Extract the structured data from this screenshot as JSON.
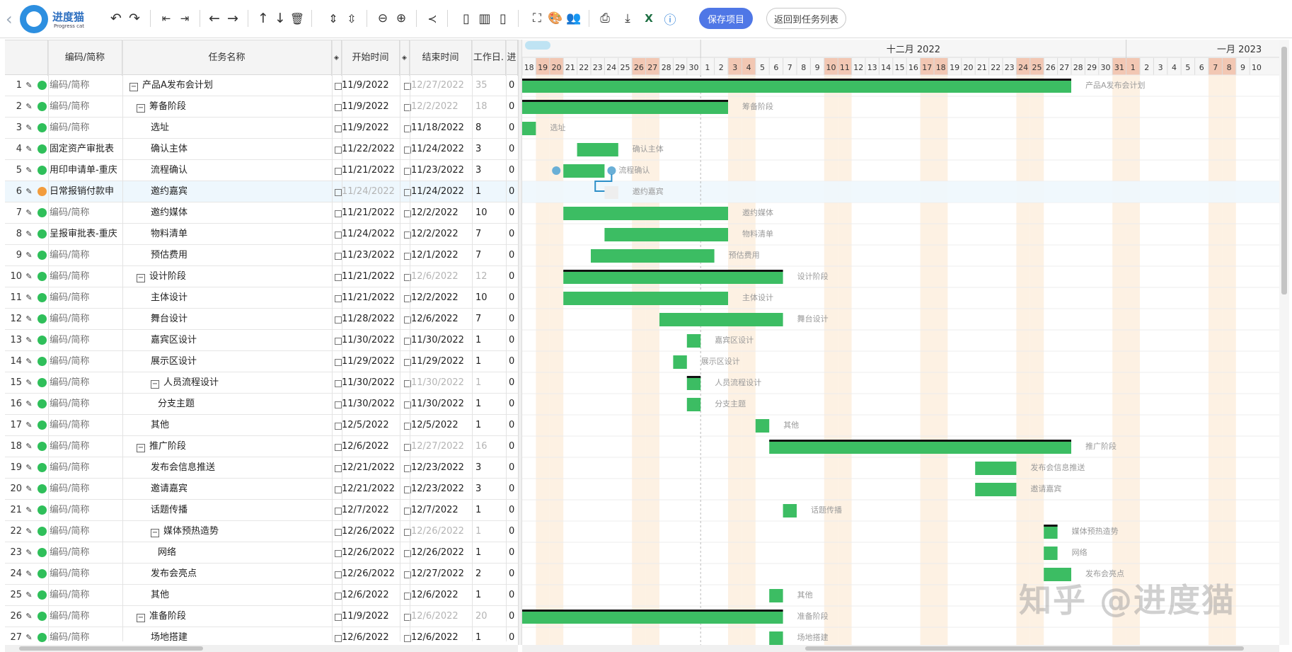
{
  "app": {
    "logo_name": "进度猫",
    "logo_sub": "Progress cat",
    "save_label": "保存项目",
    "back_label": "返回到任务列表"
  },
  "toolbar_icons": [
    "undo-icon",
    "redo-icon",
    "outdent-icon",
    "indent-icon",
    "move-left-icon",
    "move-right-icon",
    "move-up-icon",
    "move-down-icon",
    "delete-icon",
    "expand-all-icon",
    "collapse-all-icon",
    "zoom-out-icon",
    "zoom-in-icon",
    "critical-path-icon",
    "layout-left-icon",
    "layout-both-icon",
    "layout-right-icon",
    "fullscreen-icon",
    "color-palette-icon",
    "resources-icon",
    "print-icon",
    "export-icon",
    "excel-icon",
    "help-icon"
  ],
  "grid": {
    "headers": {
      "code": "编码/简称",
      "name": "任务名称",
      "start": "开始时间",
      "end": "结束时间",
      "duration": "工作日.",
      "progress": "进"
    },
    "rows": [
      {
        "idx": "1",
        "code": "编码/简称",
        "code_real": false,
        "name": "产品A发布会计划",
        "level": 0,
        "group": true,
        "start": "11/9/2022",
        "end": "12/27/2022",
        "dur": "35",
        "prog": "0",
        "dot": "green",
        "start_gray": false,
        "end_gray": true,
        "dur_gray": true
      },
      {
        "idx": "2",
        "code": "编码/简称",
        "code_real": false,
        "name": "筹备阶段",
        "level": 1,
        "group": true,
        "start": "11/9/2022",
        "end": "12/2/2022",
        "dur": "18",
        "prog": "0",
        "dot": "green",
        "start_gray": false,
        "end_gray": true,
        "dur_gray": true
      },
      {
        "idx": "3",
        "code": "编码/简称",
        "code_real": false,
        "name": "选址",
        "level": 2,
        "group": false,
        "start": "11/9/2022",
        "end": "11/18/2022",
        "dur": "8",
        "prog": "0",
        "dot": "green",
        "start_gray": false,
        "end_gray": false,
        "dur_gray": false
      },
      {
        "idx": "4",
        "code": "固定资产审批表",
        "code_real": true,
        "name": "确认主体",
        "level": 2,
        "group": false,
        "start": "11/22/2022",
        "end": "11/24/2022",
        "dur": "3",
        "prog": "0",
        "dot": "green",
        "start_gray": false,
        "end_gray": false,
        "dur_gray": false
      },
      {
        "idx": "5",
        "code": "用印申请单-重庆",
        "code_real": true,
        "name": "流程确认",
        "level": 2,
        "group": false,
        "start": "11/21/2022",
        "end": "11/23/2022",
        "dur": "3",
        "prog": "0",
        "dot": "green",
        "start_gray": false,
        "end_gray": false,
        "dur_gray": false
      },
      {
        "idx": "6",
        "code": "日常报销付款申",
        "code_real": true,
        "name": "邀约嘉宾",
        "level": 2,
        "group": false,
        "start": "11/24/2022",
        "end": "11/24/2022",
        "dur": "1",
        "prog": "0",
        "dot": "orange",
        "start_gray": true,
        "end_gray": false,
        "dur_gray": false,
        "selected": true
      },
      {
        "idx": "7",
        "code": "编码/简称",
        "code_real": false,
        "name": "邀约媒体",
        "level": 2,
        "group": false,
        "start": "11/21/2022",
        "end": "12/2/2022",
        "dur": "10",
        "prog": "0",
        "dot": "green",
        "start_gray": false,
        "end_gray": false,
        "dur_gray": false
      },
      {
        "idx": "8",
        "code": "呈报审批表-重庆",
        "code_real": true,
        "name": "物料清单",
        "level": 2,
        "group": false,
        "start": "11/24/2022",
        "end": "12/2/2022",
        "dur": "7",
        "prog": "0",
        "dot": "green",
        "start_gray": false,
        "end_gray": false,
        "dur_gray": false
      },
      {
        "idx": "9",
        "code": "编码/简称",
        "code_real": false,
        "name": "预估费用",
        "level": 2,
        "group": false,
        "start": "11/23/2022",
        "end": "12/1/2022",
        "dur": "7",
        "prog": "0",
        "dot": "green",
        "start_gray": false,
        "end_gray": false,
        "dur_gray": false
      },
      {
        "idx": "10",
        "code": "编码/简称",
        "code_real": false,
        "name": "设计阶段",
        "level": 1,
        "group": true,
        "start": "11/21/2022",
        "end": "12/6/2022",
        "dur": "12",
        "prog": "0",
        "dot": "green",
        "start_gray": false,
        "end_gray": true,
        "dur_gray": true
      },
      {
        "idx": "11",
        "code": "编码/简称",
        "code_real": false,
        "name": "主体设计",
        "level": 2,
        "group": false,
        "start": "11/21/2022",
        "end": "12/2/2022",
        "dur": "10",
        "prog": "0",
        "dot": "green",
        "start_gray": false,
        "end_gray": false,
        "dur_gray": false
      },
      {
        "idx": "12",
        "code": "编码/简称",
        "code_real": false,
        "name": "舞台设计",
        "level": 2,
        "group": false,
        "start": "11/28/2022",
        "end": "12/6/2022",
        "dur": "7",
        "prog": "0",
        "dot": "green",
        "start_gray": false,
        "end_gray": false,
        "dur_gray": false
      },
      {
        "idx": "13",
        "code": "编码/简称",
        "code_real": false,
        "name": "嘉宾区设计",
        "level": 2,
        "group": false,
        "start": "11/30/2022",
        "end": "11/30/2022",
        "dur": "1",
        "prog": "0",
        "dot": "green",
        "start_gray": false,
        "end_gray": false,
        "dur_gray": false
      },
      {
        "idx": "14",
        "code": "编码/简称",
        "code_real": false,
        "name": "展示区设计",
        "level": 2,
        "group": false,
        "start": "11/29/2022",
        "end": "11/29/2022",
        "dur": "1",
        "prog": "0",
        "dot": "green",
        "start_gray": false,
        "end_gray": false,
        "dur_gray": false
      },
      {
        "idx": "15",
        "code": "编码/简称",
        "code_real": false,
        "name": "人员流程设计",
        "level": 2,
        "group": true,
        "start": "11/30/2022",
        "end": "11/30/2022",
        "dur": "1",
        "prog": "0",
        "dot": "green",
        "start_gray": false,
        "end_gray": true,
        "dur_gray": true
      },
      {
        "idx": "16",
        "code": "编码/简称",
        "code_real": false,
        "name": "分支主题",
        "level": 3,
        "group": false,
        "start": "11/30/2022",
        "end": "11/30/2022",
        "dur": "1",
        "prog": "0",
        "dot": "green",
        "start_gray": false,
        "end_gray": false,
        "dur_gray": false
      },
      {
        "idx": "17",
        "code": "编码/简称",
        "code_real": false,
        "name": "其他",
        "level": 2,
        "group": false,
        "start": "12/5/2022",
        "end": "12/5/2022",
        "dur": "1",
        "prog": "0",
        "dot": "green",
        "start_gray": false,
        "end_gray": false,
        "dur_gray": false
      },
      {
        "idx": "18",
        "code": "编码/简称",
        "code_real": false,
        "name": "推广阶段",
        "level": 1,
        "group": true,
        "start": "12/6/2022",
        "end": "12/27/2022",
        "dur": "16",
        "prog": "0",
        "dot": "green",
        "start_gray": false,
        "end_gray": true,
        "dur_gray": true
      },
      {
        "idx": "19",
        "code": "编码/简称",
        "code_real": false,
        "name": "发布会信息推送",
        "level": 2,
        "group": false,
        "start": "12/21/2022",
        "end": "12/23/2022",
        "dur": "3",
        "prog": "0",
        "dot": "green",
        "start_gray": false,
        "end_gray": false,
        "dur_gray": false
      },
      {
        "idx": "20",
        "code": "编码/简称",
        "code_real": false,
        "name": "邀请嘉宾",
        "level": 2,
        "group": false,
        "start": "12/21/2022",
        "end": "12/23/2022",
        "dur": "3",
        "prog": "0",
        "dot": "green",
        "start_gray": false,
        "end_gray": false,
        "dur_gray": false
      },
      {
        "idx": "21",
        "code": "编码/简称",
        "code_real": false,
        "name": "话题传播",
        "level": 2,
        "group": false,
        "start": "12/7/2022",
        "end": "12/7/2022",
        "dur": "1",
        "prog": "0",
        "dot": "green",
        "start_gray": false,
        "end_gray": false,
        "dur_gray": false
      },
      {
        "idx": "22",
        "code": "编码/简称",
        "code_real": false,
        "name": "媒体预热造势",
        "level": 2,
        "group": true,
        "start": "12/26/2022",
        "end": "12/26/2022",
        "dur": "1",
        "prog": "0",
        "dot": "green",
        "start_gray": false,
        "end_gray": true,
        "dur_gray": true
      },
      {
        "idx": "23",
        "code": "编码/简称",
        "code_real": false,
        "name": "网络",
        "level": 3,
        "group": false,
        "start": "12/26/2022",
        "end": "12/26/2022",
        "dur": "1",
        "prog": "0",
        "dot": "green",
        "start_gray": false,
        "end_gray": false,
        "dur_gray": false
      },
      {
        "idx": "24",
        "code": "编码/简称",
        "code_real": false,
        "name": "发布会亮点",
        "level": 2,
        "group": false,
        "start": "12/26/2022",
        "end": "12/27/2022",
        "dur": "2",
        "prog": "0",
        "dot": "green",
        "start_gray": false,
        "end_gray": false,
        "dur_gray": false
      },
      {
        "idx": "25",
        "code": "编码/简称",
        "code_real": false,
        "name": "其他",
        "level": 2,
        "group": false,
        "start": "12/6/2022",
        "end": "12/6/2022",
        "dur": "1",
        "prog": "0",
        "dot": "green",
        "start_gray": false,
        "end_gray": false,
        "dur_gray": false
      },
      {
        "idx": "26",
        "code": "编码/简称",
        "code_real": false,
        "name": "准备阶段",
        "level": 1,
        "group": true,
        "start": "11/9/2022",
        "end": "12/6/2022",
        "dur": "20",
        "prog": "0",
        "dot": "green",
        "start_gray": false,
        "end_gray": true,
        "dur_gray": true
      },
      {
        "idx": "27",
        "code": "编码/简称",
        "code_real": false,
        "name": "场地搭建",
        "level": 2,
        "group": false,
        "start": "12/6/2022",
        "end": "12/6/2022",
        "dur": "1",
        "prog": "0",
        "dot": "green",
        "start_gray": false,
        "end_gray": false,
        "dur_gray": false
      }
    ]
  },
  "gantt": {
    "months": [
      {
        "label": "十二月 2022"
      },
      {
        "label": "一月 2023"
      }
    ],
    "timeline_start": "2022-11-18",
    "timeline_days": 54,
    "holidays": [
      "2022-11-19",
      "2022-11-20",
      "2022-11-26",
      "2022-11-27",
      "2022-12-03",
      "2022-12-04",
      "2022-12-10",
      "2022-12-11",
      "2022-12-17",
      "2022-12-18",
      "2022-12-24",
      "2022-12-25",
      "2022-12-31",
      "2023-01-01",
      "2023-01-07",
      "2023-01-08"
    ],
    "today_marker": "2022-12-01",
    "bars": [
      {
        "start": "2022-11-09",
        "end": "2022-12-27",
        "label": "产品A发布会计划",
        "summary": true
      },
      {
        "start": "2022-11-09",
        "end": "2022-12-02",
        "label": "筹备阶段",
        "summary": true
      },
      {
        "start": "2022-11-09",
        "end": "2022-11-18",
        "label": "选址",
        "summary": false
      },
      {
        "start": "2022-11-22",
        "end": "2022-11-24",
        "label": "确认主体",
        "summary": false
      },
      {
        "start": "2022-11-21",
        "end": "2022-11-23",
        "label": "流程确认",
        "summary": false,
        "handles": true
      },
      {
        "start": "2022-11-24",
        "end": "2022-11-24",
        "label": "邀约嘉宾",
        "summary": false,
        "placeholder": true
      },
      {
        "start": "2022-11-21",
        "end": "2022-12-02",
        "label": "邀约媒体",
        "summary": false
      },
      {
        "start": "2022-11-24",
        "end": "2022-12-02",
        "label": "物料清单",
        "summary": false
      },
      {
        "start": "2022-11-23",
        "end": "2022-12-01",
        "label": "预估费用",
        "summary": false
      },
      {
        "start": "2022-11-21",
        "end": "2022-12-06",
        "label": "设计阶段",
        "summary": true
      },
      {
        "start": "2022-11-21",
        "end": "2022-12-02",
        "label": "主体设计",
        "summary": false
      },
      {
        "start": "2022-11-28",
        "end": "2022-12-06",
        "label": "舞台设计",
        "summary": false
      },
      {
        "start": "2022-11-30",
        "end": "2022-11-30",
        "label": "嘉宾区设计",
        "summary": false
      },
      {
        "start": "2022-11-29",
        "end": "2022-11-29",
        "label": "展示区设计",
        "summary": false
      },
      {
        "start": "2022-11-30",
        "end": "2022-11-30",
        "label": "人员流程设计",
        "summary": true
      },
      {
        "start": "2022-11-30",
        "end": "2022-11-30",
        "label": "分支主题",
        "summary": false
      },
      {
        "start": "2022-12-05",
        "end": "2022-12-05",
        "label": "其他",
        "summary": false
      },
      {
        "start": "2022-12-06",
        "end": "2022-12-27",
        "label": "推广阶段",
        "summary": true
      },
      {
        "start": "2022-12-21",
        "end": "2022-12-23",
        "label": "发布会信息推送",
        "summary": false
      },
      {
        "start": "2022-12-21",
        "end": "2022-12-23",
        "label": "邀请嘉宾",
        "summary": false
      },
      {
        "start": "2022-12-07",
        "end": "2022-12-07",
        "label": "话题传播",
        "summary": false
      },
      {
        "start": "2022-12-26",
        "end": "2022-12-26",
        "label": "媒体预热造势",
        "summary": true
      },
      {
        "start": "2022-12-26",
        "end": "2022-12-26",
        "label": "网络",
        "summary": false
      },
      {
        "start": "2022-12-26",
        "end": "2022-12-27",
        "label": "发布会亮点",
        "summary": false
      },
      {
        "start": "2022-12-06",
        "end": "2022-12-06",
        "label": "其他",
        "summary": false
      },
      {
        "start": "2022-11-09",
        "end": "2022-12-06",
        "label": "准备阶段",
        "summary": true
      },
      {
        "start": "2022-12-06",
        "end": "2022-12-06",
        "label": "场地搭建",
        "summary": false
      }
    ],
    "colors": {
      "bar": "#3cbd63",
      "summary_line": "#111111",
      "holiday": "#fdf1e3",
      "holiday_head": "#f2c7b3",
      "label": "#9a9a9a",
      "handle": "#6aafd6"
    }
  },
  "watermark": "知乎 @进度猫"
}
